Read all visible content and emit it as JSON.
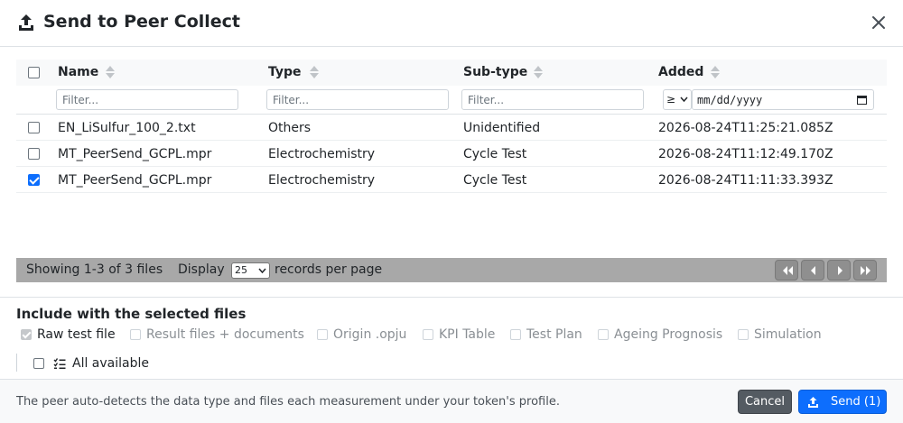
{
  "dialog": {
    "title": "Send to Peer Collect",
    "close_icon": "close-icon",
    "title_icon": "upload-icon"
  },
  "table": {
    "columns": [
      {
        "label": "Name",
        "filter_placeholder": "Filter..."
      },
      {
        "label": "Type",
        "filter_placeholder": "Filter..."
      },
      {
        "label": "Sub-type",
        "filter_placeholder": "Filter..."
      },
      {
        "label": "Added"
      }
    ],
    "added_filter": {
      "operator": "≥",
      "date_placeholder": "mm/dd/yyyy"
    },
    "rows": [
      {
        "name": "EN_LiSulfur_100_2.txt",
        "type": "Others",
        "subtype": "Unidentified",
        "added": "2026-08-24T11:25:21.085Z",
        "checked": false
      },
      {
        "name": "MT_PeerSend_GCPL.mpr",
        "type": "Electrochemistry",
        "subtype": "Cycle Test",
        "added": "2026-08-24T11:12:49.170Z",
        "checked": false
      },
      {
        "name": "MT_PeerSend_GCPL.mpr",
        "type": "Electrochemistry",
        "subtype": "Cycle Test",
        "added": "2026-08-24T11:11:33.393Z",
        "checked": true
      }
    ]
  },
  "pager": {
    "showing": "Showing 1-3 of 3 files",
    "display": "Display",
    "per_page": "25",
    "records_label": "records per page"
  },
  "include": {
    "title": "Include with the selected files",
    "options": [
      {
        "label": "Raw test file",
        "checked": true,
        "disabled": true
      },
      {
        "label": "Result files + documents",
        "checked": false,
        "disabled": true
      },
      {
        "label": "Origin .opju",
        "checked": false,
        "disabled": true
      },
      {
        "label": "KPI Table",
        "checked": false,
        "disabled": true
      },
      {
        "label": "Test Plan",
        "checked": false,
        "disabled": true
      },
      {
        "label": "Ageing Prognosis",
        "checked": false,
        "disabled": true
      },
      {
        "label": "Simulation",
        "checked": false,
        "disabled": true
      }
    ],
    "all_available": "All available"
  },
  "footer": {
    "note": "The peer auto-detects the data type and files each measurement under your token's profile.",
    "cancel": "Cancel",
    "send": "Send (1)"
  },
  "colors": {
    "primary": "#0d6efd",
    "secondary": "#545b62",
    "pager_bar": "#a8a8a8"
  }
}
